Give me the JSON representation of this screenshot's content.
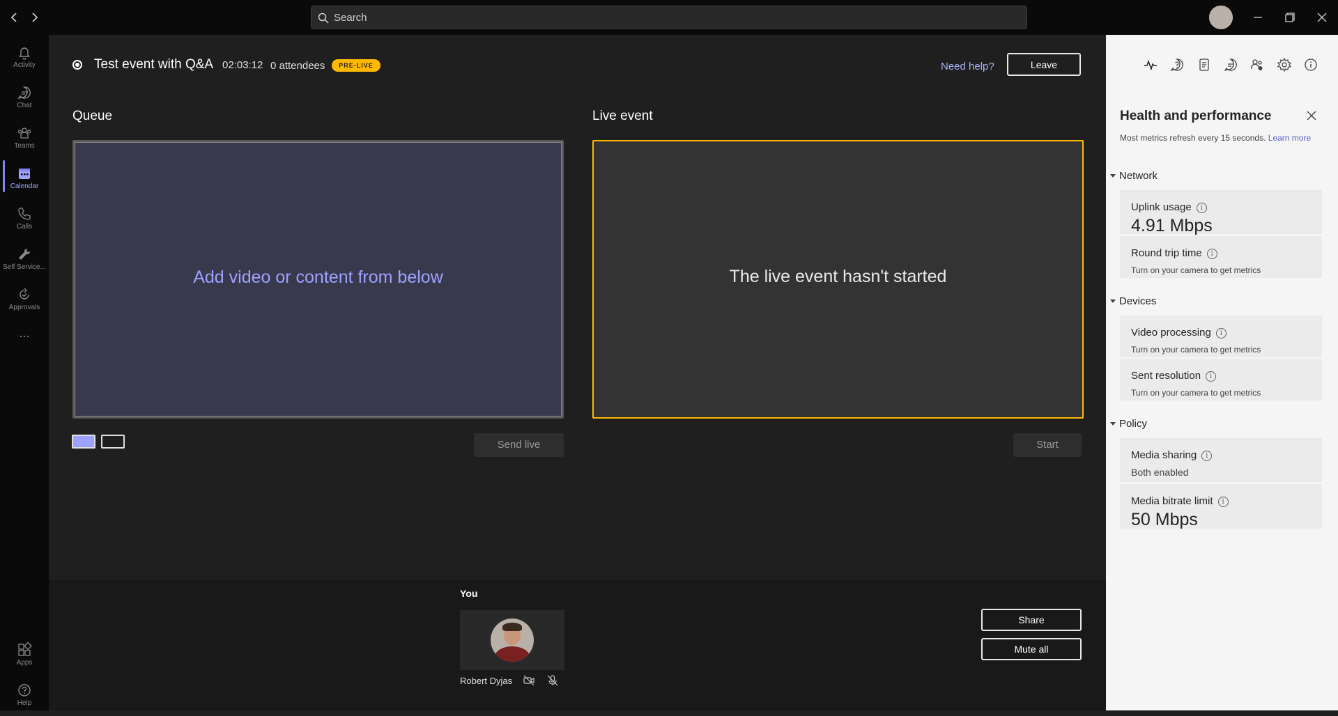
{
  "titlebar": {
    "search_placeholder": "Search",
    "window_controls": [
      "minimize-icon",
      "restore-icon",
      "close-icon"
    ]
  },
  "rail": {
    "items": [
      {
        "label": "Activity",
        "icon": "bell-icon"
      },
      {
        "label": "Chat",
        "icon": "chat-icon"
      },
      {
        "label": "Teams",
        "icon": "teams-icon"
      },
      {
        "label": "Calendar",
        "icon": "calendar-icon"
      },
      {
        "label": "Calls",
        "icon": "phone-icon"
      },
      {
        "label": "Self Service...",
        "icon": "wrench-icon"
      },
      {
        "label": "Approvals",
        "icon": "approvals-icon"
      },
      {
        "label": "Apps",
        "icon": "apps-icon"
      },
      {
        "label": "Help",
        "icon": "help-icon"
      }
    ],
    "active": "Calendar",
    "more": "..."
  },
  "event": {
    "title": "Test event with Q&A",
    "time": "02:03:12",
    "attendees": "0 attendees",
    "status_badge": "PRE-LIVE",
    "need_help": "Need help?",
    "leave": "Leave"
  },
  "queue": {
    "title": "Queue",
    "message": "Add video or content from below",
    "send_live": "Send live"
  },
  "live": {
    "title": "Live event",
    "message": "The live event hasn't started",
    "start": "Start"
  },
  "you": {
    "label": "You",
    "name": "Robert Dyjas",
    "share": "Share",
    "mute_all": "Mute all"
  },
  "panel": {
    "title": "Health and performance",
    "subtitle": "Most metrics refresh every 15 seconds.",
    "learn_more": "Learn more",
    "sections": {
      "network": "Network",
      "devices": "Devices",
      "policy": "Policy"
    },
    "metrics": {
      "uplink": {
        "label": "Uplink usage",
        "value": "4.91 Mbps"
      },
      "rtt": {
        "label": "Round trip time",
        "value": "Turn on your camera to get metrics"
      },
      "video_processing": {
        "label": "Video processing",
        "value": "Turn on your camera to get metrics"
      },
      "sent_resolution": {
        "label": "Sent resolution",
        "value": "Turn on your camera to get metrics"
      },
      "media_sharing": {
        "label": "Media sharing",
        "value": "Both enabled"
      },
      "bitrate_limit": {
        "label": "Media bitrate limit",
        "value": "50 Mbps"
      }
    }
  },
  "colors": {
    "accent": "#7f85f5",
    "live_border": "#ffb900",
    "queue_bg": "#39394d",
    "panel_bg": "#f5f5f5"
  }
}
